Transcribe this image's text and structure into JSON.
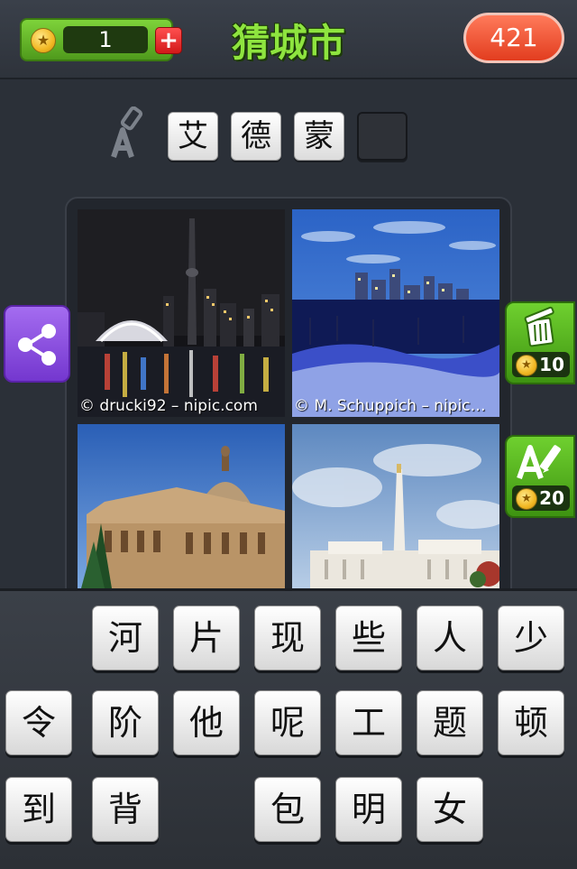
{
  "header": {
    "coins": "1",
    "add_coins_icon": "plus-icon",
    "title": "猜城市",
    "score": "421"
  },
  "answer": {
    "tiles": [
      "艾",
      "德",
      "蒙",
      ""
    ]
  },
  "photos": [
    {
      "subject": "night-skyline",
      "credit": "© drucki92 – nipic.com"
    },
    {
      "subject": "winter-skyline",
      "credit": "© M. Schuppich – nipic…"
    },
    {
      "subject": "legislature-building",
      "credit": ""
    },
    {
      "subject": "temple",
      "credit": ""
    }
  ],
  "side_buttons": {
    "share_icon": "share-icon",
    "remove_letters_cost": "10",
    "reveal_letter_cost": "20"
  },
  "keyboard": {
    "row1": [
      "河",
      "片",
      "现",
      "些",
      "人",
      "少"
    ],
    "row2": [
      "令",
      "阶",
      "他",
      "呢",
      "工",
      "题",
      "顿"
    ],
    "row3": [
      "到",
      "背",
      "包",
      "明",
      "女"
    ]
  },
  "colors": {
    "title_green": "#8ee43f",
    "score_red": "#e23d1f",
    "share_purple": "#7437cf",
    "side_green": "#3e9311"
  }
}
